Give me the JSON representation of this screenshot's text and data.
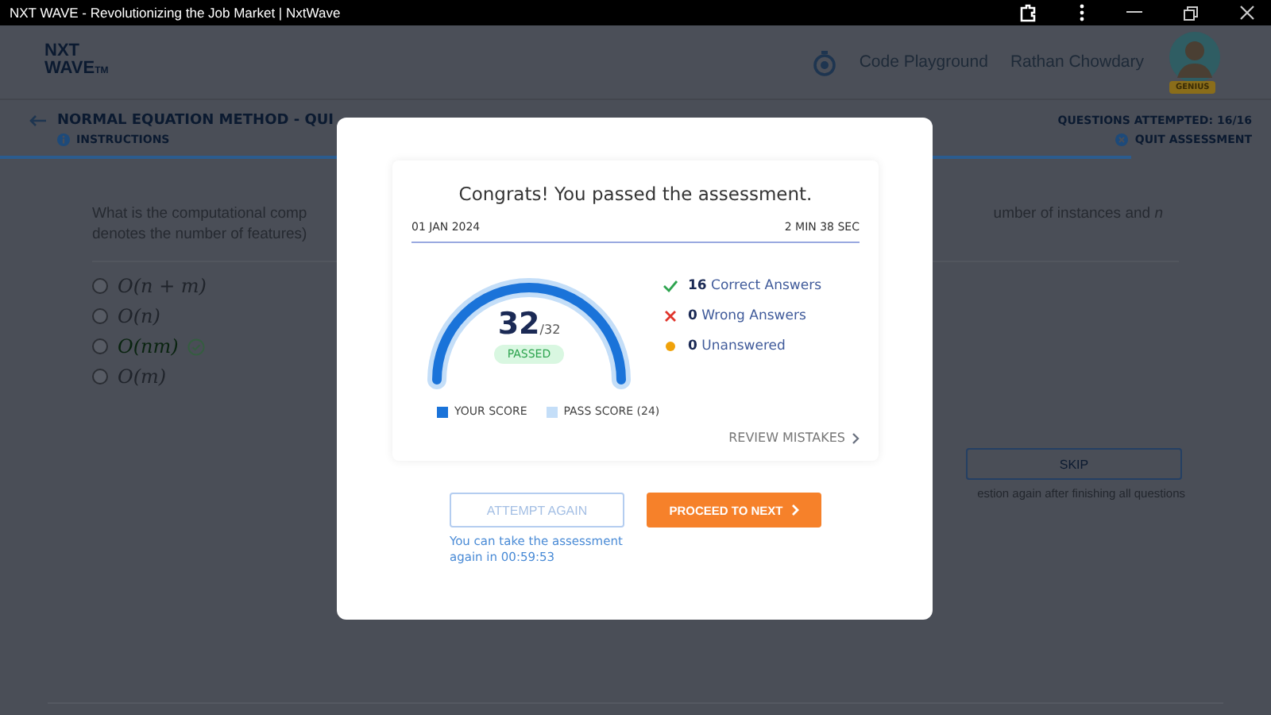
{
  "window": {
    "title": "NXT WAVE - Revolutionizing the Job Market | NxtWave"
  },
  "header": {
    "logo_top": "NXT",
    "logo_bottom": "WAVE",
    "logo_mark": "TM",
    "links": [
      "Code Playground"
    ],
    "user_name": "Rathan Chowdary",
    "badge": "GENIUS"
  },
  "quiz_bar": {
    "title": "NORMAL EQUATION METHOD - QUI",
    "instructions": "INSTRUCTIONS",
    "attempted": "QUESTIONS ATTEMPTED: 16/16",
    "quit": "QUIT ASSESSMENT",
    "level": 0.89
  },
  "question": {
    "text_left": [
      "What is the computational comp",
      "denotes the number of features)"
    ],
    "text_right": "umber of instances and *n*",
    "options": [
      {
        "text": "O(n + m)",
        "correct": false,
        "selected": false
      },
      {
        "text": "O(n)",
        "correct": false,
        "selected": false
      },
      {
        "text": "O(nm)",
        "correct": true,
        "selected": false
      },
      {
        "text": "O(m)",
        "correct": false,
        "selected": false
      }
    ],
    "skip": "SKIP",
    "skip_note": "estion again after finishing all questions"
  },
  "modal": {
    "title": "Congrats! You passed the assessment.",
    "date": "01 JAN 2024",
    "duration": "2 MIN 38 SEC",
    "score": {
      "value": "32",
      "total": "/32",
      "status": "PASSED",
      "level": 1
    },
    "stats": [
      {
        "kind": "correct",
        "text": "**16** Correct Answers"
      },
      {
        "kind": "wrong",
        "text": "**0** Wrong Answers"
      },
      {
        "kind": "unanswered",
        "text": "**0** Unanswered"
      }
    ],
    "legend": [
      {
        "label": "YOUR SCORE",
        "color": "#1a73d9"
      },
      {
        "label": "PASS SCORE (24)",
        "color": "#c4def8"
      }
    ],
    "review": "REVIEW MISTAKES",
    "attempt_again": {
      "label": "ATTEMPT AGAIN",
      "disabled": true
    },
    "retry_note": "You can take the assessment again in 00:59:53",
    "proceed": "PROCEED TO NEXT"
  }
}
